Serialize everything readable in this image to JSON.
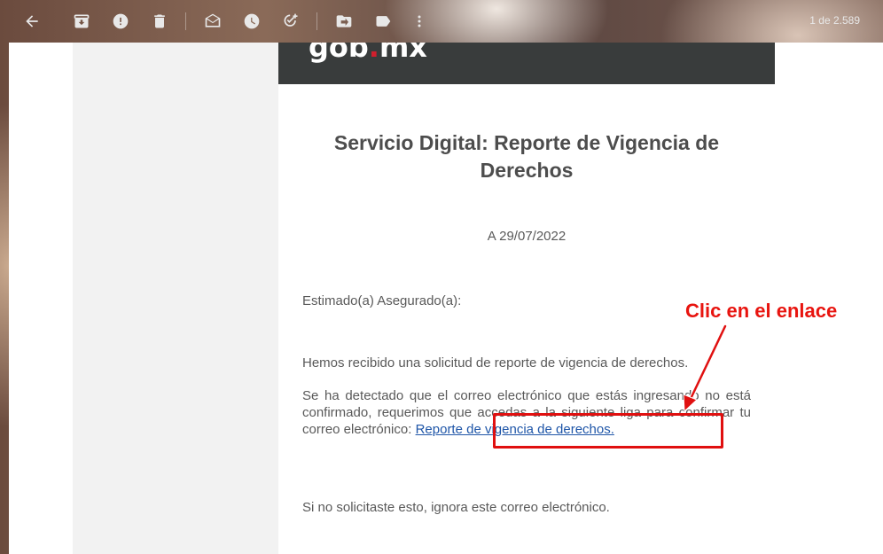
{
  "toolbar": {
    "icons": [
      "back-arrow-icon",
      "archive-icon",
      "report-spam-icon",
      "delete-icon",
      "mark-unread-icon",
      "snooze-icon",
      "add-task-icon",
      "move-to-icon",
      "label-icon",
      "more-options-icon"
    ],
    "count": "1 de 2.589"
  },
  "email": {
    "logo_main": "gob",
    "logo_dot": ".",
    "logo_tld": "mx",
    "title": "Servicio Digital: Reporte de Vigencia de Derechos",
    "date": "A 29/07/2022",
    "greeting": "Estimado(a) Asegurado(a):",
    "para1": "Hemos recibido una solicitud de reporte de vigencia de derechos.",
    "para2": "Se ha detectado que el correo electrónico que estás ingresando no está confirmado, requerimos que accedas a la siguiente liga para confirmar tu correo electrónico:",
    "link": "Reporte de vigencia de derechos.",
    "para3": "Si no solicitaste esto, ignora este correo electrónico."
  },
  "annotation": {
    "label": "Clic en el enlace",
    "color": "#e01010"
  }
}
